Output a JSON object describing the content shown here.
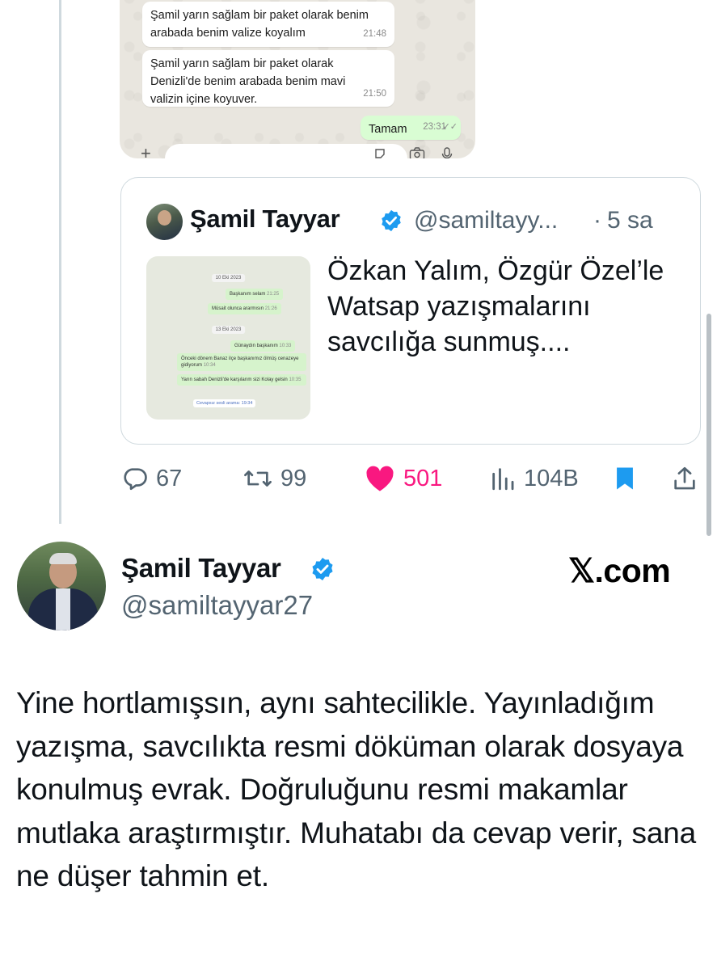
{
  "whatsapp": {
    "messages": [
      {
        "text": "Şamil yarın sağlam bir paket olarak benim arabada benim valize koyalım",
        "time": "21:48",
        "direction": "in"
      },
      {
        "text": "Şamil yarın sağlam bir paket olarak Denizli'de benim arabada benim mavi valizin içine koyuver.",
        "time": "21:50",
        "direction": "in"
      },
      {
        "text": "Tamam",
        "time": "23:31",
        "direction": "out"
      }
    ],
    "input_icons": [
      "plus-icon",
      "sticker-icon",
      "camera-icon",
      "microphone-icon"
    ]
  },
  "quoted_tweet": {
    "author_name": "Şamil Tayyar",
    "handle": "@samiltayy...",
    "separator": "·",
    "time": "5 sa",
    "text": "Özkan Yalım, Özgür Özel’le Watsap yazışmalarını savcılığa sunmuş....",
    "thumbnail": {
      "dates": [
        "10 Eki 2023",
        "13 Eki 2023"
      ],
      "messages": [
        {
          "text": "Başkanım selam",
          "time": "21:25"
        },
        {
          "text": "Müsait olunca ararmısın",
          "time": "21:26"
        },
        {
          "text": "Günaydın başkanım",
          "time": "10:33"
        },
        {
          "text": "Önceki dönem Banaz ilçe başkanımız ölmüş cenazeye gidiyorum",
          "time": "10:34"
        },
        {
          "text": "Yarın sabah Denizli'de karşılarım sizi Kolay gelsin",
          "time": "10:35"
        }
      ],
      "call": "Cevapsız sesli arama: 19:34"
    }
  },
  "actions": {
    "replies": "67",
    "retweets": "99",
    "likes": "501",
    "views": "104B",
    "like_color": "#f91880",
    "bookmark_color": "#1d9bf0"
  },
  "main_tweet": {
    "author_name": "Şamil Tayyar",
    "handle": "@samiltayyar27",
    "brand": "𝕏.com",
    "text": "Yine hortlamışsın, aynı sahtecilikle. Yayınladığım yazışma, savcılıkta resmi döküman olarak dosyaya konulmuş evrak. Doğruluğunu resmi makamlar mutlaka araştırmıştır. Muhatabı da cevap verir, sana ne düşer tahmin et."
  },
  "colors": {
    "verified": "#1d9bf0",
    "secondary_text": "#536471",
    "border": "#cfd9de",
    "whatsapp_out_bubble": "#d9fdd3"
  }
}
